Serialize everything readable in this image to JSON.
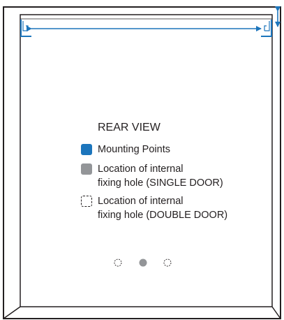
{
  "legend": {
    "title": "REAR VIEW",
    "items": [
      {
        "key": "mounting-points",
        "lines": [
          "Mounting Points"
        ],
        "swatch": "solid-blue"
      },
      {
        "key": "single-door-hole",
        "lines": [
          "Location of internal",
          "fixing hole (SINGLE DOOR)"
        ],
        "swatch": "solid-grey"
      },
      {
        "key": "double-door-hole",
        "lines": [
          "Location of internal",
          "fixing hole (DOUBLE DOOR)"
        ],
        "swatch": "dashed-outline"
      }
    ]
  },
  "colors": {
    "frame_stroke": "#231f20",
    "mounting_point": "#1c75bc",
    "single_door_hole": "#939598",
    "double_door_hole_outline": "#231f20"
  },
  "icons": {
    "width_dimension": "double-arrow-horizontal-icon",
    "height_dimension": "double-arrow-vertical-icon",
    "corner_mount": "corner-bracket-icon"
  }
}
